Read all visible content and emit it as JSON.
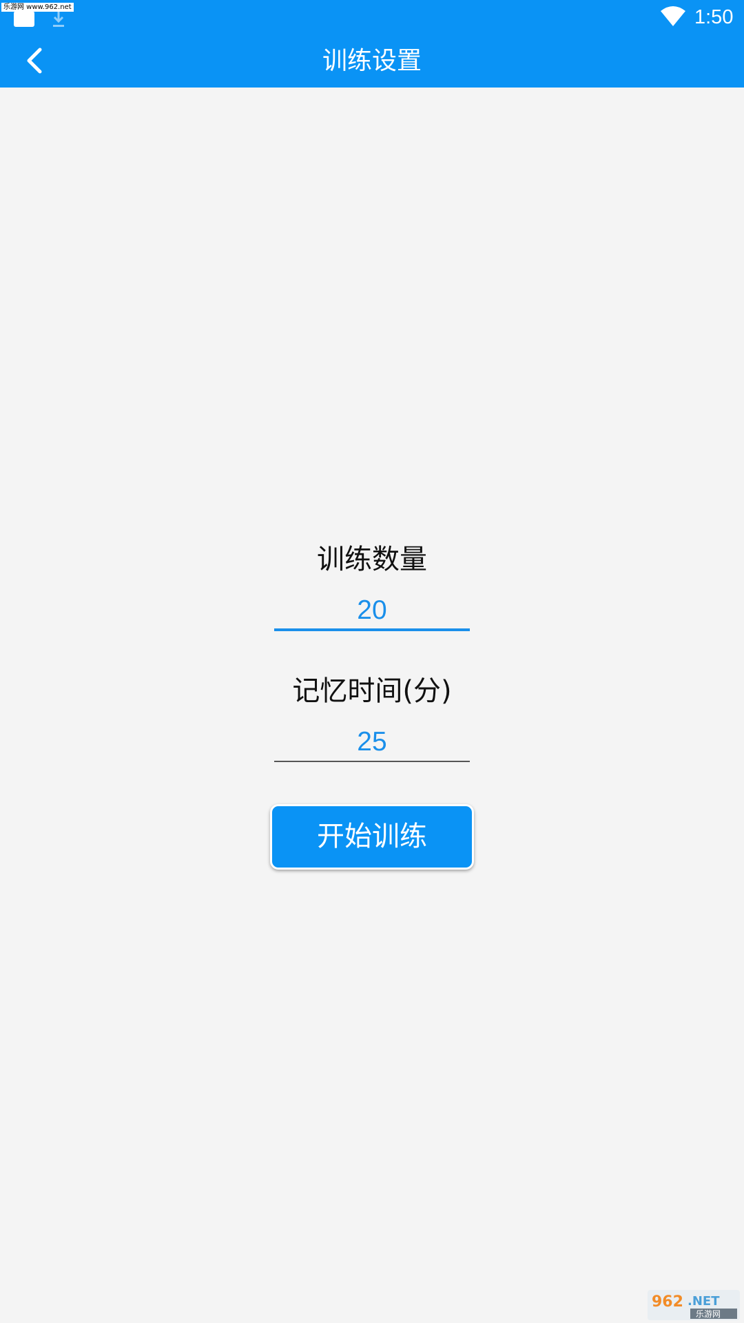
{
  "status_bar": {
    "watermark": "乐游网 www.962.net",
    "time": "1:50",
    "icons": [
      "notification-icon",
      "download-icon",
      "wifi-icon"
    ]
  },
  "app_bar": {
    "title": "训练设置",
    "back_icon": "chevron-left-icon"
  },
  "form": {
    "count_label": "训练数量",
    "count_value": "20",
    "time_label": "记忆时间(分)",
    "time_value": "25",
    "start_button": "开始训练"
  },
  "watermark_logo": {
    "text": "962.NET",
    "subtext": "乐游网"
  },
  "colors": {
    "primary": "#0a93f5",
    "input_text": "#1a8fea",
    "background": "#f4f4f4"
  }
}
